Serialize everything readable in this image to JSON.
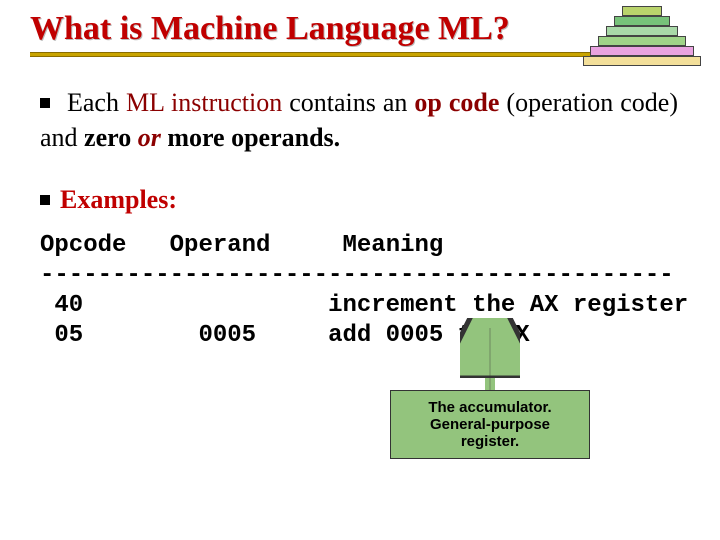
{
  "title": "What is Machine Language ML?",
  "bullet": {
    "p1": "Each",
    "p2": "ML",
    "p3": "instruction",
    "p4": "contains an",
    "p5": "op code",
    "p6": "(operation code) and",
    "p7": "zero",
    "p8": "or",
    "p9": "more operands."
  },
  "examples_label": "Examples:",
  "table": {
    "h1": "Opcode",
    "h2": "Operand",
    "h3": "Meaning",
    "dashes": "--------------------------------------------",
    "r1": {
      "opcode": "40",
      "operand": "",
      "meaning": "increment the AX register"
    },
    "r2": {
      "opcode": "05",
      "operand": "0005",
      "meaning": "add 0005 to AX"
    }
  },
  "callout": {
    "line1": "The accumulator.",
    "line2": "General-purpose",
    "line3": "register."
  }
}
